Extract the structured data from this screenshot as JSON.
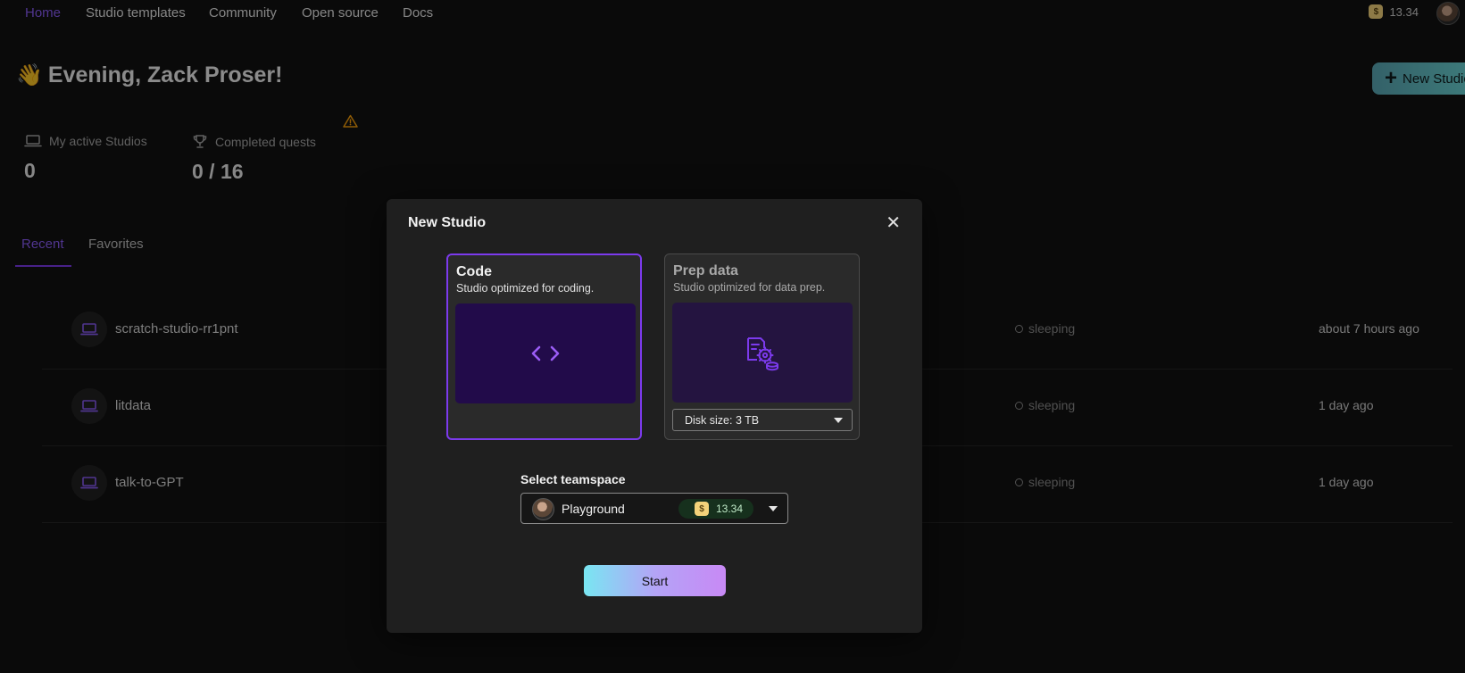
{
  "nav": {
    "items": [
      {
        "label": "Home",
        "active": true
      },
      {
        "label": "Studio templates"
      },
      {
        "label": "Community"
      },
      {
        "label": "Open source"
      },
      {
        "label": "Docs"
      }
    ],
    "credits": "13.34"
  },
  "greeting": {
    "emoji": "👋",
    "text": "Evening, Zack Proser!"
  },
  "header": {
    "new_studio_label": "New Studio"
  },
  "stats": {
    "active": {
      "label": "My active Studios",
      "value": "0"
    },
    "quests": {
      "label": "Completed quests",
      "value": "0 / 16"
    }
  },
  "tabs": [
    {
      "label": "Recent",
      "active": true
    },
    {
      "label": "Favorites"
    }
  ],
  "studios": [
    {
      "name": "scratch-studio-rr1pnt",
      "status": "sleeping",
      "time": "about 7 hours ago"
    },
    {
      "name": "litdata",
      "status": "sleeping",
      "time": "1 day ago"
    },
    {
      "name": "talk-to-GPT",
      "status": "sleeping",
      "time": "1 day ago"
    }
  ],
  "modal": {
    "title": "New Studio",
    "close_icon": "close-icon",
    "options": [
      {
        "title": "Code",
        "desc": "Studio optimized for coding.",
        "selected": true,
        "icon": "code-icon"
      },
      {
        "title": "Prep data",
        "desc": "Studio optimized for data prep.",
        "selected": false,
        "icon": "data-prep-icon",
        "disk_label": "Disk size: 3 TB"
      }
    ],
    "teamspace": {
      "label": "Select teamspace",
      "name": "Playground",
      "credits": "13.34"
    },
    "start_label": "Start"
  },
  "colors": {
    "accent": "#7c3aed",
    "background": "#121212",
    "modal_bg": "#1f1f1f",
    "warning": "#f59e0b"
  }
}
